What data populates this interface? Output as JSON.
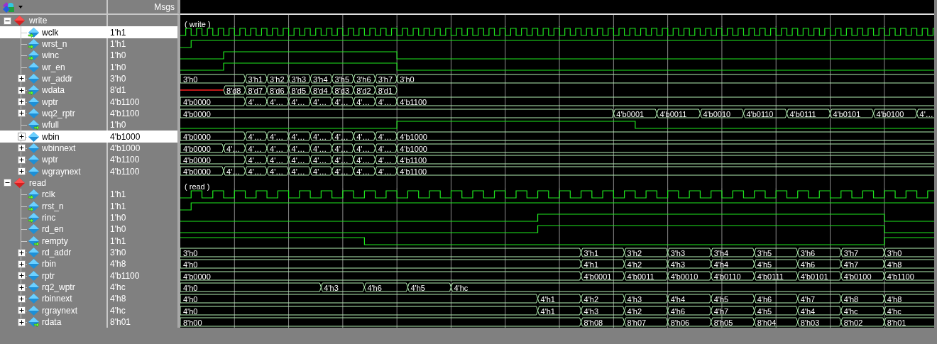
{
  "toolbar": {
    "msgs_header": "Msgs"
  },
  "groups": [
    {
      "name": "write",
      "expanded": true,
      "wave_label": "( write )",
      "signals": [
        {
          "name": "wclk",
          "value": "1'h1",
          "in_port": true,
          "out_port": false,
          "selected": true,
          "kind": "clock"
        },
        {
          "name": "wrst_n",
          "value": "1'h1",
          "in_port": true,
          "out_port": false,
          "selected": false,
          "kind": "bit"
        },
        {
          "name": "winc",
          "value": "1'h0",
          "in_port": true,
          "out_port": false,
          "selected": false,
          "kind": "bit"
        },
        {
          "name": "wr_en",
          "value": "1'h0",
          "in_port": false,
          "out_port": false,
          "selected": false,
          "kind": "bit"
        },
        {
          "name": "wr_addr",
          "value": "3'h0",
          "in_port": false,
          "out_port": false,
          "selected": false,
          "kind": "bus",
          "expanded": false,
          "segments": [
            {
              "value": "3'h0"
            },
            {
              "value": "3'h1"
            },
            {
              "value": "3'h2"
            },
            {
              "value": "3'h3"
            },
            {
              "value": "3'h4"
            },
            {
              "value": "3'h5"
            },
            {
              "value": "3'h6"
            },
            {
              "value": "3'h7"
            },
            {
              "value": "3'h0"
            }
          ]
        },
        {
          "name": "wdata",
          "value": "8'd1",
          "in_port": true,
          "out_port": false,
          "selected": false,
          "kind": "bus",
          "expanded": false,
          "segments": [
            {
              "kind": "unknown"
            },
            {
              "value": "8'd8"
            },
            {
              "value": "8'd7"
            },
            {
              "value": "8'd6"
            },
            {
              "value": "8'd5"
            },
            {
              "value": "8'd4"
            },
            {
              "value": "8'd3"
            },
            {
              "value": "8'd2"
            },
            {
              "value": "8'd1"
            },
            {
              "kind": "gap"
            }
          ]
        },
        {
          "name": "wptr",
          "value": "4'b1100",
          "in_port": false,
          "out_port": false,
          "selected": false,
          "kind": "bus",
          "expanded": false,
          "segments": [
            {
              "value": "4'b0000"
            },
            {
              "value": "4'…"
            },
            {
              "value": "4'…"
            },
            {
              "value": "4'…"
            },
            {
              "value": "4'…"
            },
            {
              "value": "4'…"
            },
            {
              "value": "4'…"
            },
            {
              "value": "4'…"
            },
            {
              "value": "4'b1100"
            }
          ]
        },
        {
          "name": "wq2_rptr",
          "value": "4'b1100",
          "in_port": false,
          "out_port": false,
          "selected": false,
          "kind": "bus",
          "expanded": false,
          "segments": [
            {
              "value": "4'b0000"
            },
            {
              "value": "4'b0001"
            },
            {
              "value": "4'b0011"
            },
            {
              "value": "4'b0010"
            },
            {
              "value": "4'b0110"
            },
            {
              "value": "4'b0111"
            },
            {
              "value": "4'b0101"
            },
            {
              "value": "4'b0100"
            },
            {
              "value": "4'…"
            }
          ]
        },
        {
          "name": "wfull",
          "value": "1'h0",
          "in_port": false,
          "out_port": true,
          "selected": false,
          "kind": "bit"
        },
        {
          "name": "wbin",
          "value": "4'b1000",
          "in_port": false,
          "out_port": false,
          "selected": true,
          "kind": "bus",
          "expanded": false,
          "segments": [
            {
              "value": "4'b0000"
            },
            {
              "value": "4'…"
            },
            {
              "value": "4'…"
            },
            {
              "value": "4'…"
            },
            {
              "value": "4'…"
            },
            {
              "value": "4'…"
            },
            {
              "value": "4'…"
            },
            {
              "value": "4'…"
            },
            {
              "value": "4'b1000"
            }
          ]
        },
        {
          "name": "wbinnext",
          "value": "4'b1000",
          "in_port": false,
          "out_port": false,
          "selected": false,
          "kind": "bus",
          "expanded": false,
          "segments": [
            {
              "value": "4'b0000"
            },
            {
              "value": "4'…"
            },
            {
              "value": "4'…"
            },
            {
              "value": "4'…"
            },
            {
              "value": "4'…"
            },
            {
              "value": "4'…"
            },
            {
              "value": "4'…"
            },
            {
              "value": "4'…"
            },
            {
              "value": "4'…"
            },
            {
              "value": "4'b1000"
            }
          ]
        },
        {
          "name": "wptr",
          "value": "4'b1100",
          "in_port": false,
          "out_port": false,
          "selected": false,
          "kind": "bus",
          "expanded": false,
          "segments": [
            {
              "value": "4'b0000"
            },
            {
              "value": "4'…"
            },
            {
              "value": "4'…"
            },
            {
              "value": "4'…"
            },
            {
              "value": "4'…"
            },
            {
              "value": "4'…"
            },
            {
              "value": "4'…"
            },
            {
              "value": "4'…"
            },
            {
              "value": "4'b1100"
            }
          ]
        },
        {
          "name": "wgraynext",
          "value": "4'b1100",
          "in_port": false,
          "out_port": false,
          "selected": false,
          "kind": "bus",
          "expanded": false,
          "segments": [
            {
              "value": "4'b0000"
            },
            {
              "value": "4'…"
            },
            {
              "value": "4'…"
            },
            {
              "value": "4'…"
            },
            {
              "value": "4'…"
            },
            {
              "value": "4'…"
            },
            {
              "value": "4'…"
            },
            {
              "value": "4'…"
            },
            {
              "value": "4'…"
            },
            {
              "value": "4'b1100"
            }
          ]
        }
      ]
    },
    {
      "name": "read",
      "expanded": true,
      "wave_label": "( read )",
      "signals": [
        {
          "name": "rclk",
          "value": "1'h1",
          "in_port": true,
          "out_port": false,
          "selected": false,
          "kind": "clock"
        },
        {
          "name": "rrst_n",
          "value": "1'h1",
          "in_port": true,
          "out_port": false,
          "selected": false,
          "kind": "bit"
        },
        {
          "name": "rinc",
          "value": "1'h0",
          "in_port": true,
          "out_port": false,
          "selected": false,
          "kind": "bit"
        },
        {
          "name": "rd_en",
          "value": "1'h0",
          "in_port": false,
          "out_port": false,
          "selected": false,
          "kind": "bit"
        },
        {
          "name": "rempty",
          "value": "1'h1",
          "in_port": false,
          "out_port": true,
          "selected": false,
          "kind": "bit"
        },
        {
          "name": "rd_addr",
          "value": "3'h0",
          "in_port": false,
          "out_port": false,
          "selected": false,
          "kind": "bus",
          "expanded": false,
          "segments": [
            {
              "value": "3'h0"
            },
            {
              "value": "3'h1"
            },
            {
              "value": "3'h2"
            },
            {
              "value": "3'h3"
            },
            {
              "value": "3'h4"
            },
            {
              "value": "3'h5"
            },
            {
              "value": "3'h6"
            },
            {
              "value": "3'h7"
            },
            {
              "value": "3'h0"
            }
          ]
        },
        {
          "name": "rbin",
          "value": "4'h8",
          "in_port": false,
          "out_port": false,
          "selected": false,
          "kind": "bus",
          "expanded": false,
          "segments": [
            {
              "value": "4'h0"
            },
            {
              "value": "4'h1"
            },
            {
              "value": "4'h2"
            },
            {
              "value": "4'h3"
            },
            {
              "value": "4'h4"
            },
            {
              "value": "4'h5"
            },
            {
              "value": "4'h6"
            },
            {
              "value": "4'h7"
            },
            {
              "value": "4'h8"
            }
          ]
        },
        {
          "name": "rptr",
          "value": "4'b1100",
          "in_port": false,
          "out_port": false,
          "selected": false,
          "kind": "bus",
          "expanded": false,
          "segments": [
            {
              "value": "4'b0000"
            },
            {
              "value": "4'b0001"
            },
            {
              "value": "4'b0011"
            },
            {
              "value": "4'b0010"
            },
            {
              "value": "4'b0110"
            },
            {
              "value": "4'b0111"
            },
            {
              "value": "4'b0101"
            },
            {
              "value": "4'b0100"
            },
            {
              "value": "4'b1100"
            }
          ]
        },
        {
          "name": "rq2_wptr",
          "value": "4'hc",
          "in_port": false,
          "out_port": false,
          "selected": false,
          "kind": "bus",
          "expanded": false,
          "segments": [
            {
              "value": "4'h0"
            },
            {
              "value": "4'h3"
            },
            {
              "value": "4'h6"
            },
            {
              "value": "4'h5"
            },
            {
              "value": "4'hc"
            }
          ]
        },
        {
          "name": "rbinnext",
          "value": "4'h8",
          "in_port": false,
          "out_port": false,
          "selected": false,
          "kind": "bus",
          "expanded": false,
          "segments": [
            {
              "value": "4'h0"
            },
            {
              "value": "4'h1"
            },
            {
              "value": "4'h2"
            },
            {
              "value": "4'h3"
            },
            {
              "value": "4'h4"
            },
            {
              "value": "4'h5"
            },
            {
              "value": "4'h6"
            },
            {
              "value": "4'h7"
            },
            {
              "value": "4'h8"
            },
            {
              "value": "4'h8"
            }
          ]
        },
        {
          "name": "rgraynext",
          "value": "4'hc",
          "in_port": false,
          "out_port": false,
          "selected": false,
          "kind": "bus",
          "expanded": false,
          "segments": [
            {
              "value": "4'h0"
            },
            {
              "value": "4'h1"
            },
            {
              "value": "4'h3"
            },
            {
              "value": "4'h2"
            },
            {
              "value": "4'h6"
            },
            {
              "value": "4'h7"
            },
            {
              "value": "4'h5"
            },
            {
              "value": "4'h4"
            },
            {
              "value": "4'hc"
            },
            {
              "value": "4'hc"
            }
          ]
        },
        {
          "name": "rdata",
          "value": "8'h01",
          "in_port": false,
          "out_port": true,
          "selected": false,
          "kind": "bus",
          "expanded": false,
          "segments": [
            {
              "value": "8'h00"
            },
            {
              "value": "8'h08"
            },
            {
              "value": "8'h07"
            },
            {
              "value": "8'h06"
            },
            {
              "value": "8'h05"
            },
            {
              "value": "8'h04"
            },
            {
              "value": "8'h03"
            },
            {
              "value": "8'h02"
            },
            {
              "value": "8'h01"
            }
          ]
        }
      ]
    }
  ]
}
